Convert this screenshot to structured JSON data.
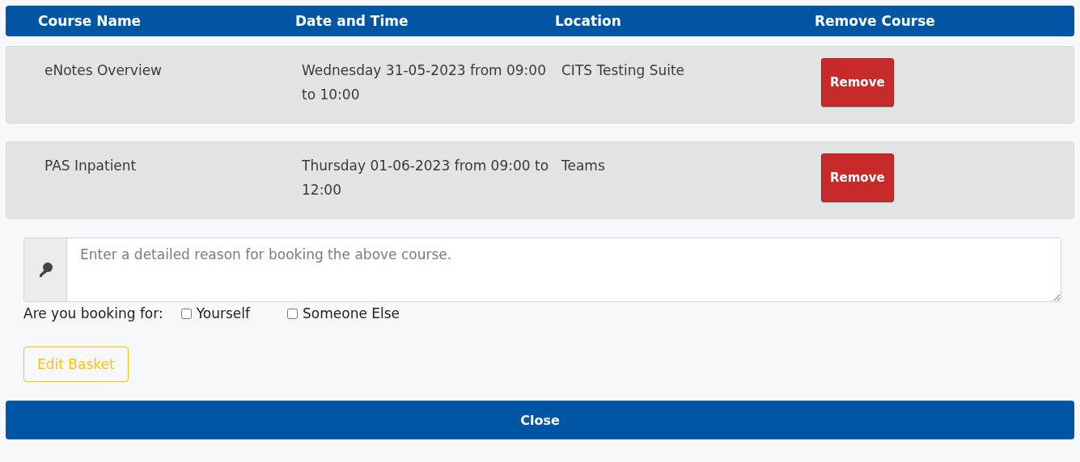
{
  "table": {
    "columns": [
      "Course Name",
      "Date and Time",
      "Location",
      "Remove Course"
    ],
    "rows": [
      {
        "name": "eNotes Overview",
        "date_time": "Wednesday 31-05-2023 from 09:00 to 10:00",
        "location": "CITS Testing Suite",
        "action": "Remove"
      },
      {
        "name": "PAS Inpatient",
        "date_time": "Thursday 01-06-2023 from 09:00 to 12:00",
        "location": "Teams",
        "action": "Remove"
      }
    ]
  },
  "reason": {
    "placeholder": "Enter a detailed reason for booking the above course."
  },
  "booking_for": {
    "label": "Are you booking for:",
    "options": [
      {
        "label": "Yourself",
        "checked": false
      },
      {
        "label": "Someone Else",
        "checked": false
      }
    ]
  },
  "edit_button": "Edit Basket",
  "close_button": "Close"
}
